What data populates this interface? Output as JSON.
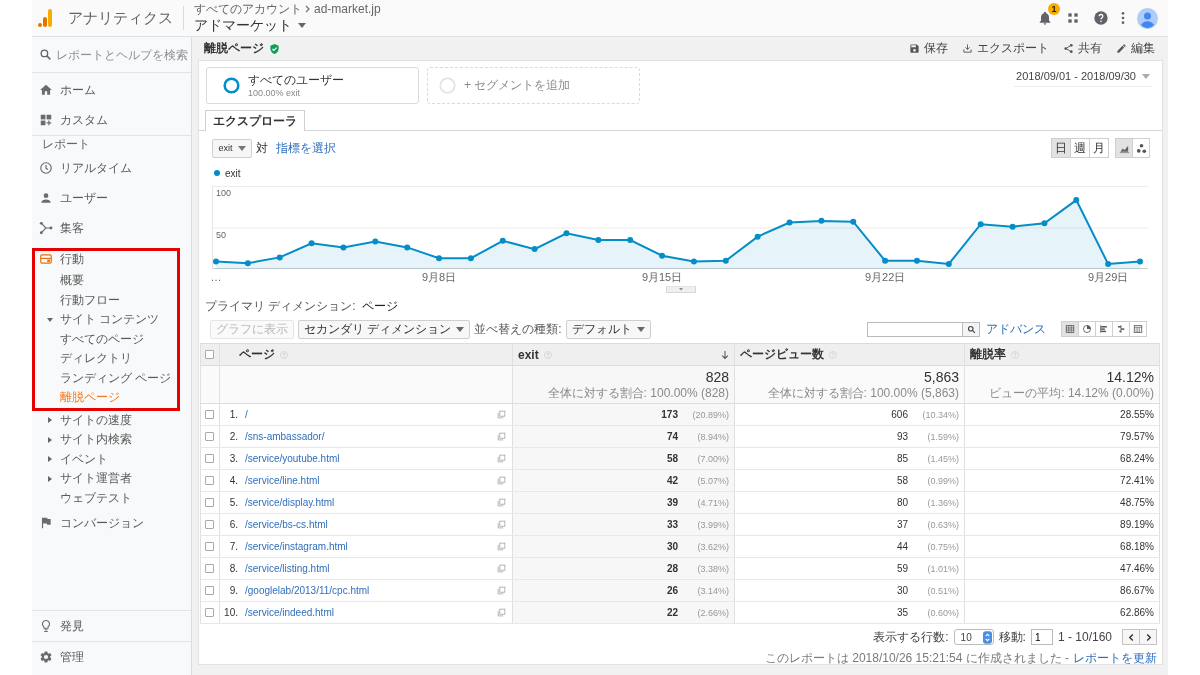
{
  "topbar": {
    "product": "アナリティクス",
    "breadcrumb": [
      "すべてのアカウント",
      "ad-market.jp"
    ],
    "property": "アドマーケット",
    "notification_badge": "1"
  },
  "sidebar": {
    "search_placeholder": "レポートとヘルプを検索",
    "top_items": [
      {
        "label": "ホーム",
        "selected": false
      },
      {
        "label": "カスタム",
        "selected": false
      }
    ],
    "section_label": "レポート",
    "report_items": [
      {
        "label": "リアルタイム",
        "selected": false,
        "highlighted": false
      },
      {
        "label": "ユーザー",
        "selected": false,
        "highlighted": false
      },
      {
        "label": "集客",
        "selected": false,
        "highlighted": false
      },
      {
        "label": "行動",
        "selected": true,
        "highlighted": true,
        "children": [
          {
            "label": "概要",
            "kind": "page",
            "selected": false
          },
          {
            "label": "行動フロー",
            "kind": "page",
            "selected": false
          },
          {
            "label": "サイト コンテンツ",
            "kind": "folder",
            "expanded": true,
            "selected": false,
            "children": [
              {
                "label": "すべてのページ",
                "kind": "page",
                "selected": false
              },
              {
                "label": "ディレクトリ",
                "kind": "page",
                "selected": false
              },
              {
                "label": "ランディング ページ",
                "kind": "page",
                "selected": false
              },
              {
                "label": "離脱ページ",
                "kind": "page",
                "selected": true
              }
            ]
          },
          {
            "label": "サイトの速度",
            "kind": "folder",
            "expanded": false,
            "selected": false
          },
          {
            "label": "サイト内検索",
            "kind": "folder",
            "expanded": false,
            "selected": false
          },
          {
            "label": "イベント",
            "kind": "folder",
            "expanded": false,
            "selected": false
          },
          {
            "label": "サイト運営者",
            "kind": "folder",
            "expanded": false,
            "selected": false
          },
          {
            "label": "ウェブテスト",
            "kind": "page",
            "selected": false
          }
        ]
      },
      {
        "label": "コンバージョン",
        "selected": false,
        "highlighted": false
      }
    ],
    "bottom_items": [
      {
        "label": "発見"
      },
      {
        "label": "管理"
      }
    ]
  },
  "report": {
    "title": "離脱ページ",
    "actions": [
      {
        "label": "保存"
      },
      {
        "label": "エクスポート"
      },
      {
        "label": "共有"
      },
      {
        "label": "編集"
      }
    ],
    "segments": [
      {
        "kind": "segment",
        "name": "すべてのユーザー",
        "detail": "100.00% exit"
      },
      {
        "kind": "add",
        "name": "+ セグメントを追加"
      }
    ],
    "date_range": "2018/09/01 - 2018/09/30",
    "tabs": [
      {
        "label": "エクスプローラ",
        "selected": true
      }
    ]
  },
  "chart_controls": {
    "metric": "exit",
    "versus": "対",
    "select_metric": "指標を選択",
    "intervals": [
      {
        "label": "日",
        "selected": true
      },
      {
        "label": "週",
        "selected": false
      },
      {
        "label": "月",
        "selected": false
      }
    ],
    "chart_types": [
      {
        "selected": true
      },
      {
        "selected": false
      }
    ]
  },
  "chart": {
    "chart_data": {
      "type": "area",
      "categories": [
        "…",
        null,
        null,
        null,
        null,
        null,
        null,
        "9月8日",
        null,
        null,
        null,
        null,
        null,
        null,
        "9月15日",
        null,
        null,
        null,
        null,
        null,
        null,
        "9月22日",
        null,
        null,
        null,
        null,
        null,
        null,
        "9月29日",
        null
      ],
      "ylim": [
        0,
        100
      ],
      "yticks": [
        50,
        100
      ],
      "series": [
        {
          "name": "exit",
          "color": "#058dc7",
          "values": [
            9,
            7,
            14,
            31,
            26,
            33,
            26,
            13,
            13,
            34,
            24,
            43,
            35,
            35,
            16,
            9,
            10,
            39,
            56,
            58,
            57,
            10,
            10,
            6,
            54,
            51,
            55,
            83,
            6,
            9
          ]
        }
      ]
    }
  },
  "table_controls": {
    "primary_label": "プライマリ ディメンション:",
    "primary_value": "ページ",
    "plot_button": {
      "label": "グラフに表示",
      "disabled": true
    },
    "secondary_dimension": "セカンダリ ディメンション",
    "sort_label": "並べ替えの種類:",
    "sort_value": "デフォルト",
    "advanced_link": "アドバンス",
    "views": [
      {
        "selected": true
      },
      {
        "selected": false
      },
      {
        "selected": false
      },
      {
        "selected": false
      },
      {
        "selected": false
      }
    ]
  },
  "table": {
    "header_checked": false,
    "columns": [
      {
        "label": "ページ",
        "sorted": false
      },
      {
        "label": "exit",
        "sorted": true
      },
      {
        "label": "ページビュー数",
        "sorted": false
      },
      {
        "label": "離脱率",
        "sorted": false
      }
    ],
    "totals": [
      {
        "value": "828",
        "note": "全体に対する割合: 100.00% (828)"
      },
      {
        "value": "5,863",
        "note": "全体に対する割合: 100.00% (5,863)"
      },
      {
        "value": "14.12%",
        "note": "ビューの平均: 14.12% (0.00%)"
      }
    ],
    "rows": [
      {
        "checked": false,
        "index": "1.",
        "page": "/",
        "exit": "173",
        "exit_share": "(20.89%)",
        "pageviews": "606",
        "pageviews_share": "(10.34%)",
        "exit_rate": "28.55%"
      },
      {
        "checked": false,
        "index": "2.",
        "page": "/sns-ambassador/",
        "exit": "74",
        "exit_share": "(8.94%)",
        "pageviews": "93",
        "pageviews_share": "(1.59%)",
        "exit_rate": "79.57%"
      },
      {
        "checked": false,
        "index": "3.",
        "page": "/service/youtube.html",
        "exit": "58",
        "exit_share": "(7.00%)",
        "pageviews": "85",
        "pageviews_share": "(1.45%)",
        "exit_rate": "68.24%"
      },
      {
        "checked": false,
        "index": "4.",
        "page": "/service/line.html",
        "exit": "42",
        "exit_share": "(5.07%)",
        "pageviews": "58",
        "pageviews_share": "(0.99%)",
        "exit_rate": "72.41%"
      },
      {
        "checked": false,
        "index": "5.",
        "page": "/service/display.html",
        "exit": "39",
        "exit_share": "(4.71%)",
        "pageviews": "80",
        "pageviews_share": "(1.36%)",
        "exit_rate": "48.75%"
      },
      {
        "checked": false,
        "index": "6.",
        "page": "/service/bs-cs.html",
        "exit": "33",
        "exit_share": "(3.99%)",
        "pageviews": "37",
        "pageviews_share": "(0.63%)",
        "exit_rate": "89.19%"
      },
      {
        "checked": false,
        "index": "7.",
        "page": "/service/instagram.html",
        "exit": "30",
        "exit_share": "(3.62%)",
        "pageviews": "44",
        "pageviews_share": "(0.75%)",
        "exit_rate": "68.18%"
      },
      {
        "checked": false,
        "index": "8.",
        "page": "/service/listing.html",
        "exit": "28",
        "exit_share": "(3.38%)",
        "pageviews": "59",
        "pageviews_share": "(1.01%)",
        "exit_rate": "47.46%"
      },
      {
        "checked": false,
        "index": "9.",
        "page": "/googlelab/2013/11/cpc.html",
        "exit": "26",
        "exit_share": "(3.14%)",
        "pageviews": "30",
        "pageviews_share": "(0.51%)",
        "exit_rate": "86.67%"
      },
      {
        "checked": false,
        "index": "10.",
        "page": "/service/indeed.html",
        "exit": "22",
        "exit_share": "(2.66%)",
        "pageviews": "35",
        "pageviews_share": "(0.60%)",
        "exit_rate": "62.86%"
      }
    ]
  },
  "pagination": {
    "rows_label": "表示する行数:",
    "rows_value": "10",
    "goto_label": "移動:",
    "goto_value": "1",
    "range": "1 - 10/160"
  },
  "footnote": {
    "text": "このレポートは 2018/10/26 15:21:54 に作成されました -",
    "link": "レポートを更新"
  }
}
